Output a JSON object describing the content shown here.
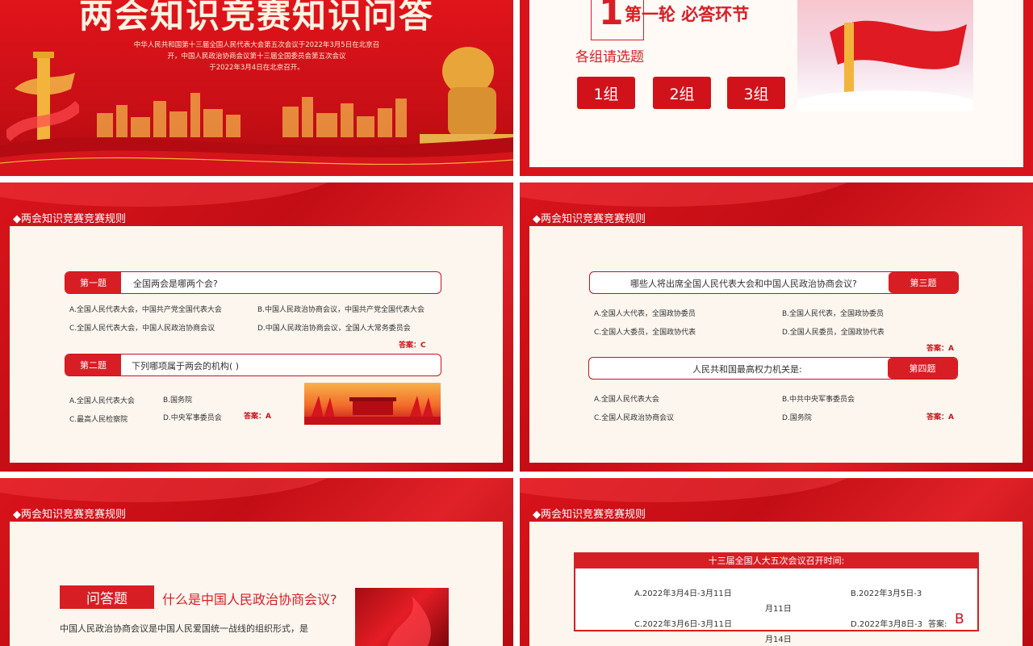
{
  "slide1": {
    "title": "两会知识竞赛知识问答",
    "subtitle_lines": [
      "中华人民共和国第十三届全国人民代表大会第五次会议于2022年3月5日在北京召",
      "开，中国人民政治协商会议第十三届全国委员会第五次会议",
      "于2022年3月4日在北京召开。"
    ]
  },
  "slide2": {
    "round_number": "1",
    "round_title": "第一轮 必答环节",
    "prompt": "各组请选题",
    "groups": [
      "1组",
      "2组",
      "3组"
    ]
  },
  "slide3": {
    "header": "◆两会知识竞赛竞赛规则",
    "q1": {
      "tag": "第一题",
      "question": "全国两会是哪两个会?",
      "options": [
        "A.全国人民代表大会，中国共产党全国代表大会",
        "B.中国人民政治协商会议，中国共产党全国代表大会",
        "C.全国人民代表大会，中国人民政治协商会议",
        "D.中国人民政治协商会议，全国人大常务委员会"
      ],
      "answer": "答案：C"
    },
    "q2": {
      "tag": "第二题",
      "question": "下列哪项属于两会的机构(   )",
      "options": [
        "A.全国人民代表大会",
        "B.国务院",
        "C.最高人民检察院",
        "D.中央军事委员会"
      ],
      "answer": "答案：A"
    }
  },
  "slide4": {
    "header": "◆两会知识竞赛竞赛规则",
    "q3": {
      "tag": "第三题",
      "question": "哪些人将出席全国人民代表大会和中国人民政治协商会议?",
      "options": [
        "A.全国人大代表，全国政协委员",
        "B.全国人民代表，全国政协委员",
        "C.全国人大委员，全国政协代表",
        "D.全国人民委员，全国政协代表"
      ],
      "answer": "答案：A"
    },
    "q4": {
      "tag": "第四题",
      "question": "人民共和国最高权力机关是:",
      "options": [
        "A.全国人民代表大会",
        "B.中共中央军事委员会",
        "C.全国人民政治协商会议",
        "D.国务院"
      ],
      "answer": "答案：A"
    }
  },
  "slide5": {
    "header": "◆两会知识竞赛竞赛规则",
    "tag": "问答题",
    "question": "什么是中国人民政治协商会议?",
    "body": "中国人民政治协商会议是中国人民爱国统一战线的组织形式，是"
  },
  "slide6": {
    "header": "◆两会知识竞赛竞赛规则",
    "title": "十三届全国人大五次会议召开时间:",
    "optA": "A.2022年3月4日-3月11日",
    "optB": "B.2022年3月5日-3",
    "optB2": "月11日",
    "optC": "C.2022年3月6日-3月11日",
    "optD": "D.2022年3月8日-3",
    "optD2": "月14日",
    "answer_label": "答案:",
    "answer_value": "B"
  },
  "colors": {
    "primary_red": "#d81e25",
    "panel_cream": "#fdf6ef",
    "gold": "#f2b43a"
  }
}
